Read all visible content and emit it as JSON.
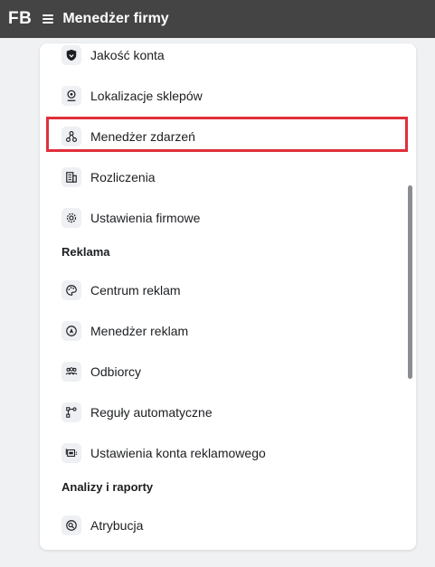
{
  "topbar": {
    "logo": "FB",
    "title": "Menedżer firmy"
  },
  "menu": {
    "items_top": [
      {
        "label": "Jakość konta",
        "icon": "shield-icon"
      },
      {
        "label": "Lokalizacje sklepów",
        "icon": "map-pin-icon"
      },
      {
        "label": "Menedżer zdarzeń",
        "icon": "event-nodes-icon",
        "highlighted": true
      },
      {
        "label": "Rozliczenia",
        "icon": "billing-icon"
      },
      {
        "label": "Ustawienia firmowe",
        "icon": "gear-icon"
      }
    ],
    "section_ads": "Reklama",
    "items_ads": [
      {
        "label": "Centrum reklam",
        "icon": "palette-icon"
      },
      {
        "label": "Menedżer reklam",
        "icon": "navigation-arrow-icon"
      },
      {
        "label": "Odbiorcy",
        "icon": "audience-icon"
      },
      {
        "label": "Reguły automatyczne",
        "icon": "rules-icon"
      },
      {
        "label": "Ustawienia konta reklamowego",
        "icon": "ad-account-settings-icon"
      }
    ],
    "section_analytics": "Analizy i raporty",
    "items_analytics": [
      {
        "label": "Atrybucja",
        "icon": "attribution-icon"
      }
    ]
  },
  "colors": {
    "topbar": "#444444",
    "highlight": "#e0303a",
    "panel": "#ffffff",
    "background": "#f0f1f3"
  }
}
